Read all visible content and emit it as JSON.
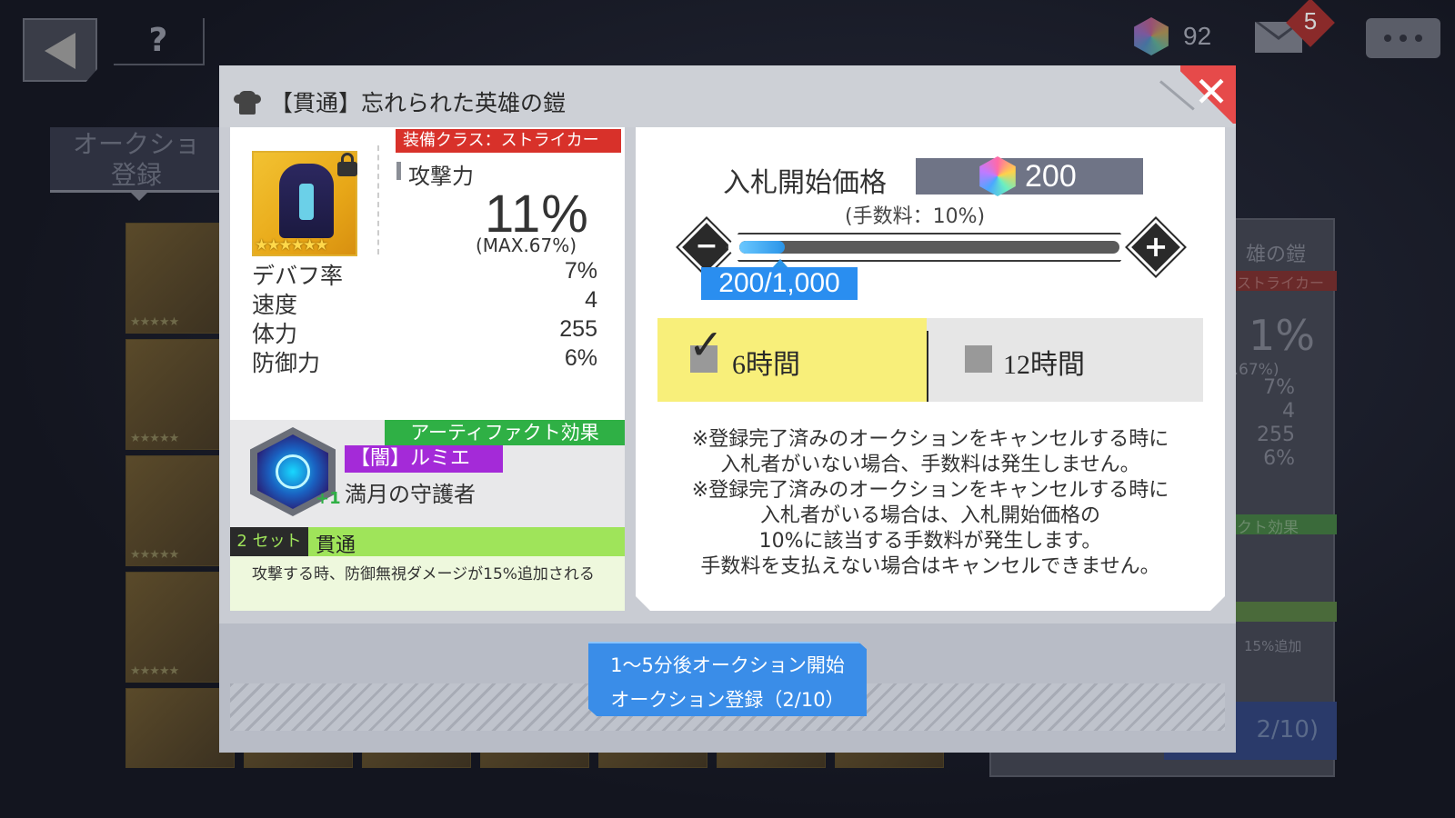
{
  "topbar": {
    "help_label": "?",
    "gem_count": "92",
    "mail_badge": "5"
  },
  "background": {
    "tab_label_line1": "オークショ",
    "tab_label_line2": "登録",
    "right_panel": {
      "title": "雄の鎧",
      "class": "ストライカー",
      "big": "1%",
      "max": "X.67%)",
      "values": [
        "7%",
        "4",
        "255",
        "6%"
      ],
      "artifact": "クト効果",
      "desc": "15%追加",
      "btn": "2/10)"
    },
    "grid_stars": "★★★★★"
  },
  "modal": {
    "title": "【貫通】忘れられた英雄の鎧",
    "close_label": "✕",
    "item": {
      "stars": "★★★★★★",
      "class_tag": "装備クラス：ストライカー",
      "main_stat_label": "攻撃力",
      "main_stat_value": "11%",
      "main_stat_max": "(MAX.67%)",
      "stats": [
        {
          "label": "デバフ率",
          "value": "7%"
        },
        {
          "label": "速度",
          "value": "4"
        },
        {
          "label": "体力",
          "value": "255"
        },
        {
          "label": "防御力",
          "value": "6%"
        }
      ],
      "artifact_tag": "アーティファクト効果",
      "artifact_name": "【闇】ルミエ",
      "artifact_sub": "満月の守護者",
      "artifact_plus": "+1",
      "set_tag": "2 セット",
      "set_name": "貫通",
      "set_desc": "攻撃する時、防御無視ダメージが15%追加される"
    },
    "auction": {
      "price_label": "入札開始価格",
      "price_value": "200",
      "fee_note": "(手数料：10%)",
      "slider_value_label": "200/1,000",
      "slider_min": 0,
      "slider_max": 1000,
      "slider_value": 200,
      "durations": [
        {
          "label": "6時間",
          "selected": true
        },
        {
          "label": "12時間",
          "selected": false
        }
      ],
      "check_mark": "✓",
      "notice_lines": [
        "※登録完了済みのオークションをキャンセルする時に",
        "入札者がいない場合、手数料は発生しません。",
        "※登録完了済みのオークションをキャンセルする時に",
        "入札者がいる場合は、入札開始価格の",
        "10%に該当する手数料が発生します。",
        "手数料を支払えない場合はキャンセルできません。"
      ]
    },
    "register_button": {
      "line1": "1〜5分後オークション開始",
      "line2": "オークション登録（2/10）"
    }
  },
  "colors": {
    "close": "#e64a4a",
    "class_tag": "#d8312a",
    "artifact_tag": "#2fb045",
    "artifact_name": "#a42ad8",
    "set_bar": "#9fe45a",
    "selected_duration": "#f8ef7a",
    "register_button": "#3a8de8",
    "slider_value": "#2a8ef0"
  }
}
